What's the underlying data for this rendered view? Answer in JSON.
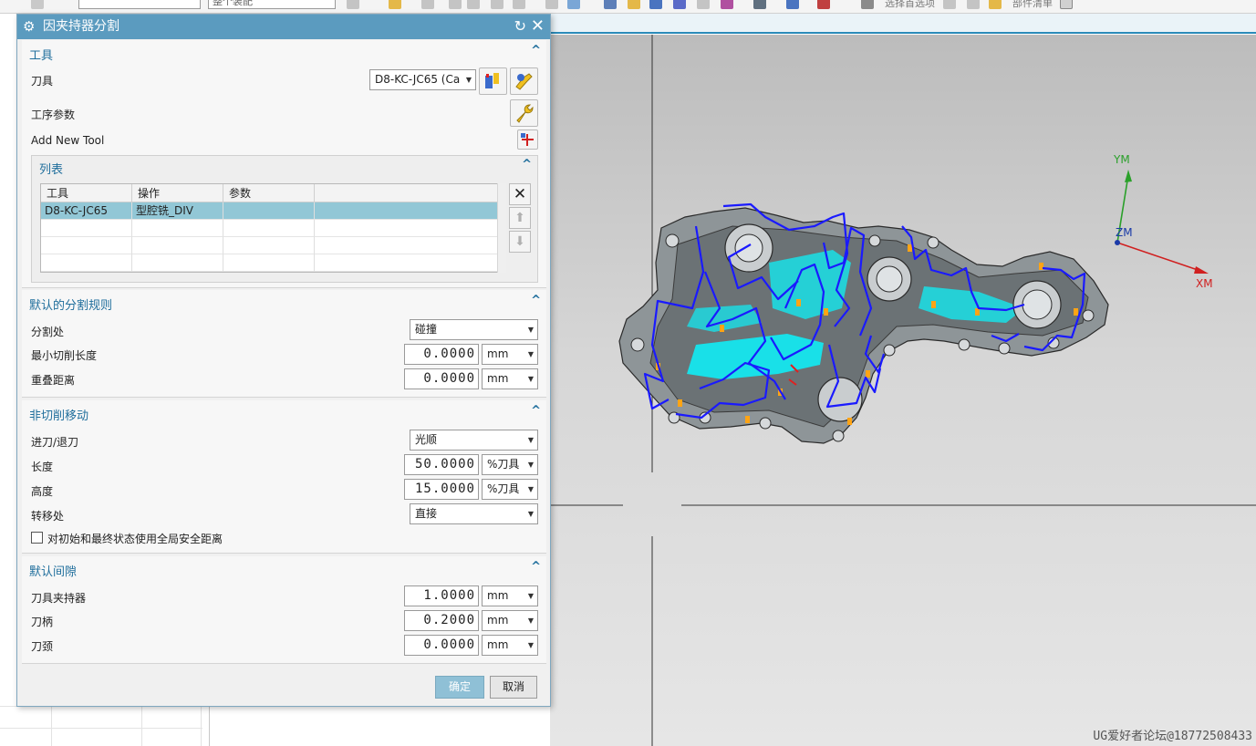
{
  "dialog": {
    "title": "因夹持器分割",
    "tool_group": {
      "header": "工具",
      "tool_label": "刀具",
      "tool_value": "D8-KC-JC65 (Ca",
      "op_params_label": "工序参数",
      "add_tool_label": "Add New Tool"
    },
    "list_group": {
      "header": "列表",
      "columns": [
        "工具",
        "操作",
        "参数",
        ""
      ],
      "rows": [
        [
          "D8-KC-JC65",
          "型腔铣_DIV",
          "",
          ""
        ]
      ]
    },
    "split_rules": {
      "header": "默认的分割规则",
      "split_at_label": "分割处",
      "split_at_value": "碰撞",
      "min_cut_len_label": "最小切削长度",
      "min_cut_len_value": "0.0000",
      "min_cut_len_unit": "mm",
      "overlap_label": "重叠距离",
      "overlap_value": "0.0000",
      "overlap_unit": "mm"
    },
    "non_cutting": {
      "header": "非切削移动",
      "engage_label": "进刀/退刀",
      "engage_value": "光顺",
      "length_label": "长度",
      "length_value": "50.0000",
      "length_unit": "%刀具",
      "height_label": "高度",
      "height_value": "15.0000",
      "height_unit": "%刀具",
      "transfer_label": "转移处",
      "transfer_value": "直接",
      "safe_check_label": "对初始和最终状态使用全局安全距离"
    },
    "clearance": {
      "header": "默认间隙",
      "holder_label": "刀具夹持器",
      "holder_value": "1.0000",
      "holder_unit": "mm",
      "shank_label": "刀柄",
      "shank_value": "0.2000",
      "shank_unit": "mm",
      "neck_label": "刀颈",
      "neck_value": "0.0000",
      "neck_unit": "mm"
    },
    "ok_label": "确定",
    "cancel_label": "取消"
  },
  "toolbar": {
    "combo_text": "整个装配",
    "right_text_1": "选择首选项",
    "right_text_2": "部件清单"
  },
  "viewport": {
    "axis_y": "YM",
    "axis_z": "ZM",
    "axis_x": "XM"
  },
  "watermark": "UG爱好者论坛@18772508433",
  "icons": [
    "gear-icon",
    "reset-icon",
    "close-icon",
    "tool-edit-icon",
    "new-tool-icon",
    "wrench-icon",
    "add-tool-icon",
    "delete-icon",
    "move-up-icon",
    "move-down-icon"
  ],
  "colors": {
    "title_bar": "#5b9bbf",
    "group_header": "#1f6e9c",
    "selected_row": "#92c7d6",
    "ok_button": "#8fc0d6",
    "toolpath": "#1a1aff",
    "cyan_region": "#19e0e8"
  }
}
